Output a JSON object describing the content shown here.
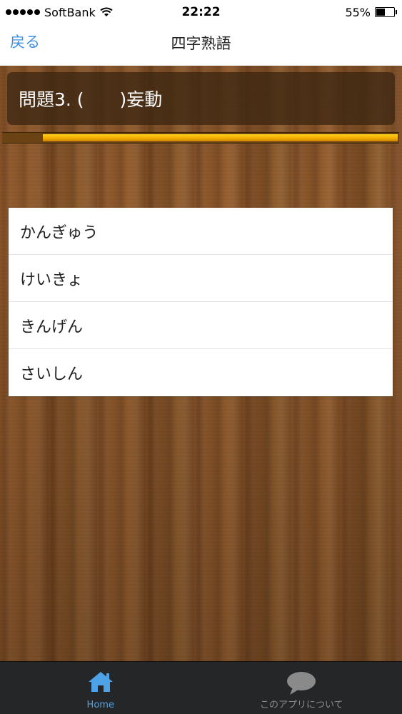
{
  "status_bar": {
    "carrier": "SoftBank",
    "time": "22:22",
    "battery_text": "55%",
    "battery_level": 0.55,
    "signal_icon": "signal-dots-icon",
    "wifi_icon": "wifi-icon"
  },
  "nav": {
    "back_label": "戻る",
    "title": "四字熟語"
  },
  "question": {
    "text": "問題3. (　　)妄動"
  },
  "progress": {
    "value": 0.9
  },
  "answers": [
    "かんぎゅう",
    "けいきょ",
    "きんげん",
    "さいしん"
  ],
  "tabs": [
    {
      "label": "Home",
      "icon": "home-icon",
      "active": true
    },
    {
      "label": "このアプリについて",
      "icon": "speech-bubble-icon",
      "active": false
    }
  ],
  "colors": {
    "accent": "#3d8fe0",
    "tab_active": "#4ea3e8",
    "progress_fill": "#f0a800",
    "tabbar_bg": "#242628"
  }
}
